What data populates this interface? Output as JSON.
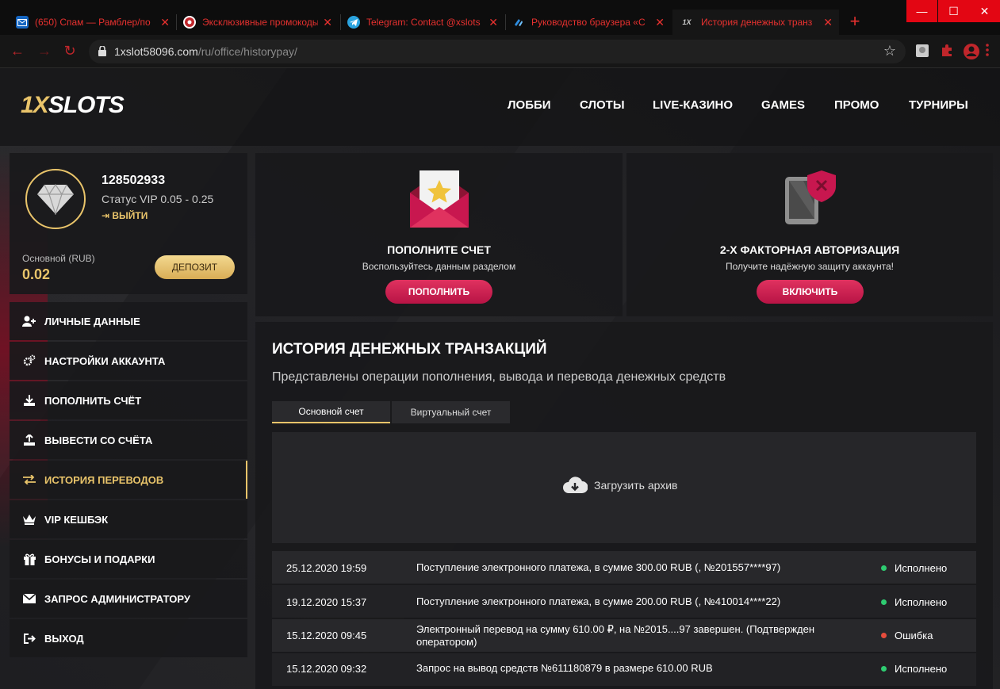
{
  "browser": {
    "tabs": [
      {
        "title": "(650) Спам — Рамблер/по",
        "icon": "mail-icon"
      },
      {
        "title": "Эксклюзивные промокоды",
        "icon": "casino-chip-icon"
      },
      {
        "title": "Telegram: Contact @xslots",
        "icon": "telegram-icon"
      },
      {
        "title": "Руководство браузера «С",
        "icon": "browser-guide-icon"
      },
      {
        "title": "История денежных транз",
        "icon": "1x-icon",
        "fav_text": "1X"
      }
    ],
    "url_host": "1xslot58096.com",
    "url_path": "/ru/office/historypay/",
    "window_controls": [
      "—",
      "☐",
      "✕"
    ],
    "new_tab": "+"
  },
  "site": {
    "logo_a": "1X",
    "logo_b": "SLOTS",
    "nav": [
      "ЛОББИ",
      "СЛОТЫ",
      "LIVE-КАЗИНО",
      "GAMES",
      "ПРОМО",
      "ТУРНИРЫ"
    ]
  },
  "profile": {
    "user_id": "128502933",
    "status": "Статус VIP 0.05 - 0.25",
    "logout": "ВЫЙТИ",
    "balance_label": "Основной (RUB)",
    "balance": "0.02",
    "deposit": "ДЕПОЗИТ"
  },
  "sidebar": [
    {
      "label": "ЛИЧНЫЕ ДАННЫЕ",
      "icon": "user-add-icon"
    },
    {
      "label": "НАСТРОЙКИ АККАУНТА",
      "icon": "gears-icon"
    },
    {
      "label": "ПОПОЛНИТЬ СЧЁТ",
      "icon": "download-icon"
    },
    {
      "label": "ВЫВЕСТИ СО СЧЁТА",
      "icon": "upload-icon"
    },
    {
      "label": "ИСТОРИЯ ПЕРЕВОДОВ",
      "icon": "exchange-icon",
      "active": true
    },
    {
      "label": "VIP КЕШБЭК",
      "icon": "crown-icon"
    },
    {
      "label": "БОНУСЫ И ПОДАРКИ",
      "icon": "gift-icon"
    },
    {
      "label": "ЗАПРОС АДМИНИСТРАТОРУ",
      "icon": "envelope-icon"
    },
    {
      "label": "ВЫХОД",
      "icon": "logout-icon"
    }
  ],
  "cards": [
    {
      "title": "ПОПОЛНИТЕ СЧЕТ",
      "subtitle": "Воспользуйтесь данным разделом",
      "button": "ПОПОЛНИТЬ",
      "icon": "envelope-star-icon"
    },
    {
      "title": "2-Х ФАКТОРНАЯ АВТОРИЗАЦИЯ",
      "subtitle": "Получите надёжную защиту аккаунта!",
      "button": "ВКЛЮЧИТЬ",
      "icon": "phone-shield-icon"
    }
  ],
  "history": {
    "title": "ИСТОРИЯ ДЕНЕЖНЫХ ТРАНЗАКЦИЙ",
    "subtitle": "Представлены операции пополнения, вывода и перевода денежных средств",
    "tabs": [
      "Основной счет",
      "Виртуальный счет"
    ],
    "archive": "Загрузить архив",
    "rows": [
      {
        "date": "25.12.2020 19:59",
        "desc": "Поступление электронного платежа, в сумме 300.00 RUB (, №201557****97)",
        "status": "Исполнено",
        "ok": true
      },
      {
        "date": "19.12.2020 15:37",
        "desc": "Поступление электронного платежа, в сумме 200.00 RUB (, №410014****22)",
        "status": "Исполнено",
        "ok": true
      },
      {
        "date": "15.12.2020 09:45",
        "desc": "Электронный перевод на сумму 610.00 ₽, на №2015....97 завершен. (Подтвержден оператором)",
        "status": "Ошибка",
        "ok": false
      },
      {
        "date": "15.12.2020 09:32",
        "desc": "Запрос на вывод средств №611180879 в размере 610.00 RUB",
        "status": "Исполнено",
        "ok": true
      }
    ]
  },
  "colors": {
    "accent_gold": "#e9c46a",
    "accent_red": "#c8174f",
    "ok_green": "#2ecc71",
    "error_red": "#e74c3c",
    "chrome_red": "#e8312f"
  }
}
